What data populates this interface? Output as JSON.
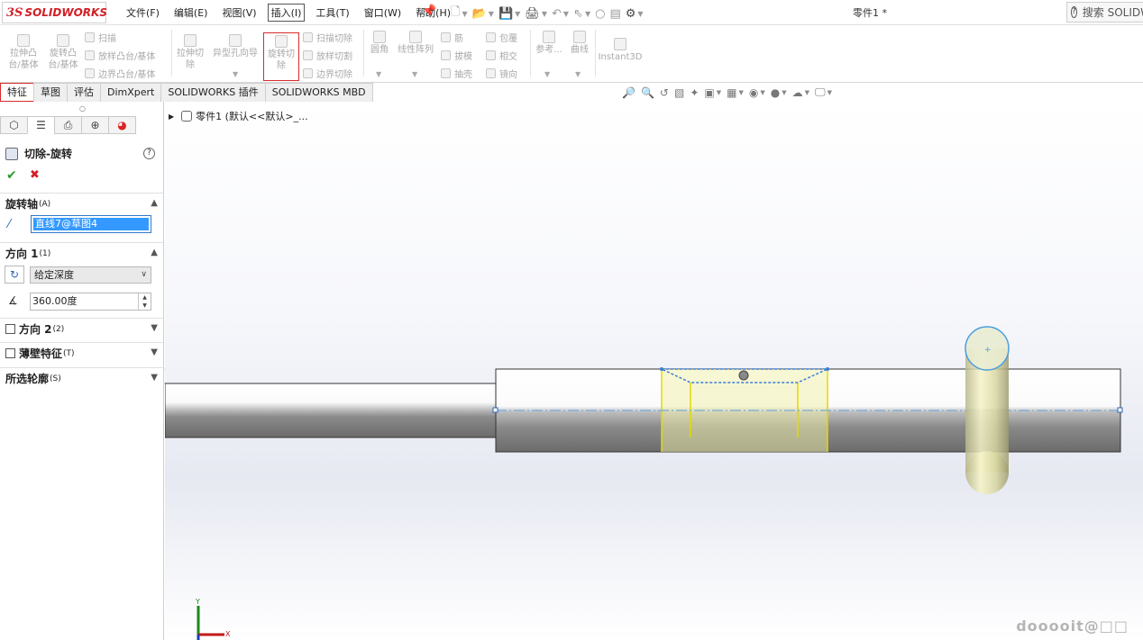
{
  "app": {
    "logo_ds": "3S",
    "logo_word": "SOLIDWORKS",
    "document_title": "零件1 *"
  },
  "menu": [
    {
      "label": "文件(F)"
    },
    {
      "label": "编辑(E)"
    },
    {
      "label": "视图(V)"
    },
    {
      "label": "插入(I)",
      "active": true
    },
    {
      "label": "工具(T)"
    },
    {
      "label": "窗口(W)"
    },
    {
      "label": "帮助(H)"
    }
  ],
  "search": {
    "label": "搜索 SOLIDW"
  },
  "ribbon": {
    "extrude_boss": "拉伸凸\n台/基体",
    "revolve_boss": "旋转凸\n台/基体",
    "sweep": "扫描",
    "loft": "放样凸台/基体",
    "boundary_boss": "边界凸台/基体",
    "extrude_cut": "拉伸切\n除",
    "hole_wizard": "异型孔向导",
    "revolve_cut": "旋转切\n除",
    "sweep_cut": "扫描切除",
    "loft_cut": "放样切割",
    "boundary_cut": "边界切除",
    "fillet": "圆角",
    "linear_pattern": "线性阵列",
    "rib": "筋",
    "draft": "拔模",
    "shell": "抽壳",
    "wrap": "包覆",
    "intersect": "相交",
    "mirror": "镜向",
    "reference": "参考...",
    "curves": "曲线",
    "instant3d": "Instant3D"
  },
  "tabs": [
    {
      "label": "特征",
      "active": true
    },
    {
      "label": "草图"
    },
    {
      "label": "评估"
    },
    {
      "label": "DimXpert"
    },
    {
      "label": "SOLIDWORKS 插件"
    },
    {
      "label": "SOLIDWORKS MBD"
    }
  ],
  "property_manager": {
    "title": "切除-旋转",
    "help": "?",
    "axis_section": "旋转轴",
    "axis_key": "(A)",
    "axis_value": "直线7@草图4",
    "dir1_section": "方向 1",
    "dir1_key": "(1)",
    "end_condition": "给定深度",
    "angle": "360.00度",
    "dir2_section": "方向 2",
    "dir2_key": "(2)",
    "thin_section": "薄壁特征",
    "thin_key": "(T)",
    "contours_section": "所选轮廓",
    "contours_key": "(S)"
  },
  "tree": {
    "root_label": "零件1 (默认<<默认>_..."
  },
  "axes": {
    "x": "X",
    "y": "Y"
  },
  "watermark": "dooooit@□□",
  "colors": {
    "accent_red": "#d62c2c",
    "selection_blue": "#3399ff",
    "preview_yellow": "#f2f0b0"
  }
}
